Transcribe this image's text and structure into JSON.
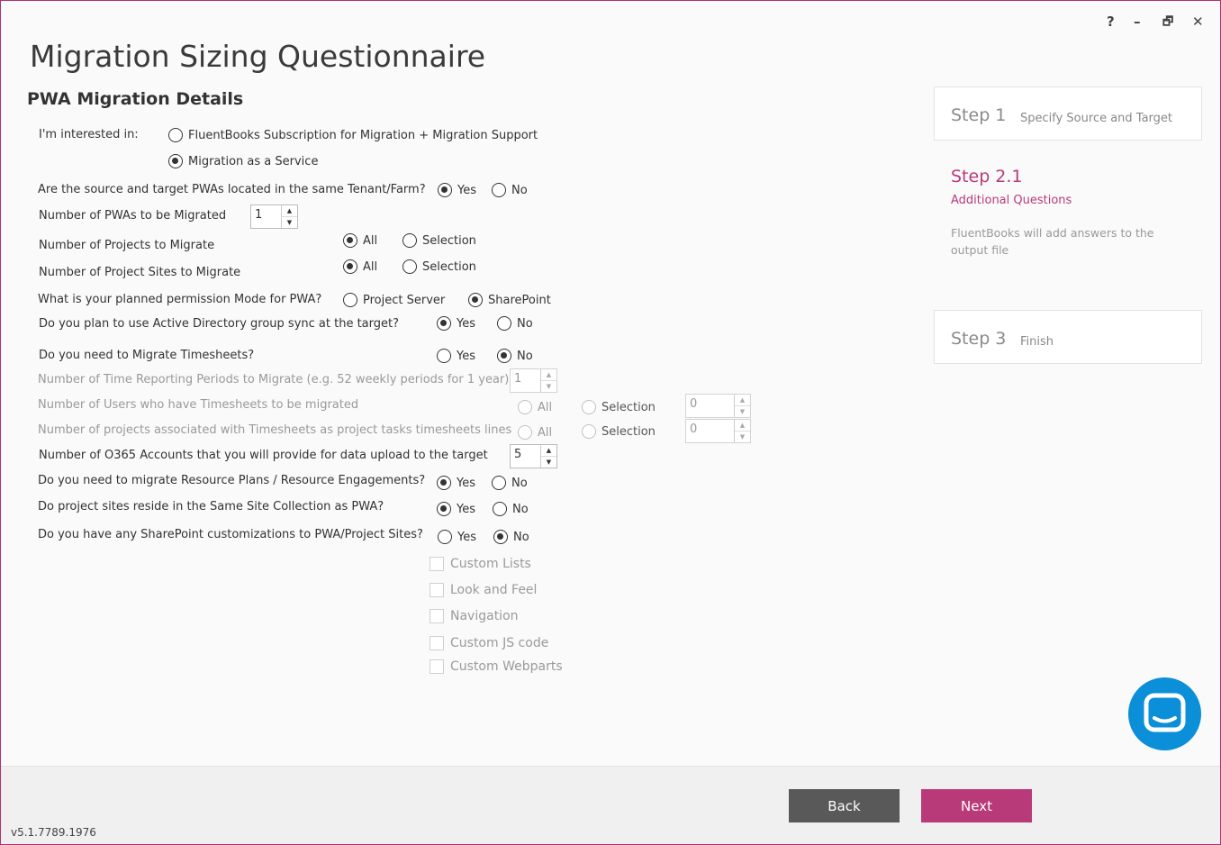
{
  "window_controls": {
    "help": "?",
    "minimize": "–",
    "restore": "🗗",
    "close": "✕"
  },
  "header": {
    "title": "Migration Sizing Questionnaire",
    "subtitle": "PWA Migration Details"
  },
  "form": {
    "interested": {
      "label": "I'm interested in:",
      "opt1": "FluentBooks Subscription for Migration + Migration Support",
      "opt2": "Migration as a Service"
    },
    "same_tenant": {
      "label": "Are the source and target PWAs located in the same Tenant/Farm?",
      "yes": "Yes",
      "no": "No"
    },
    "num_pwas": {
      "label": "Number of PWAs to be Migrated",
      "value": "1"
    },
    "num_projects": {
      "label": "Number of Projects to Migrate",
      "all": "All",
      "selection": "Selection"
    },
    "num_sites": {
      "label": "Number of Project Sites to Migrate",
      "all": "All",
      "selection": "Selection"
    },
    "permission_mode": {
      "label": "What is your planned permission Mode for PWA?",
      "opt1": "Project Server",
      "opt2": "SharePoint"
    },
    "ad_sync": {
      "label": "Do you plan to use Active Directory group sync at the target?",
      "yes": "Yes",
      "no": "No"
    },
    "timesheets": {
      "label": "Do you need to Migrate Timesheets?",
      "yes": "Yes",
      "no": "No"
    },
    "periods": {
      "label": "Number of Time Reporting Periods to Migrate (e.g. 52 weekly periods for 1 year)",
      "value": "1"
    },
    "ts_users": {
      "label": "Number of Users who have Timesheets to be migrated",
      "all": "All",
      "selection": "Selection",
      "value": "0"
    },
    "ts_projects": {
      "label": "Number of projects associated with Timesheets as project tasks timesheets lines",
      "all": "All",
      "selection": "Selection",
      "value": "0"
    },
    "o365": {
      "label": "Number of O365 Accounts that you will provide for data upload to the target",
      "value": "5"
    },
    "resource_plans": {
      "label": "Do you need to migrate Resource Plans / Resource Engagements?",
      "yes": "Yes",
      "no": "No"
    },
    "same_site": {
      "label": "Do project sites reside in the Same Site Collection as PWA?",
      "yes": "Yes",
      "no": "No"
    },
    "customizations": {
      "label": "Do you have any SharePoint customizations to PWA/Project Sites?",
      "yes": "Yes",
      "no": "No"
    },
    "checks": [
      "Custom Lists",
      "Look and Feel",
      "Navigation",
      "Custom JS code",
      "Custom Webparts"
    ]
  },
  "steps": {
    "step1": {
      "num": "Step 1",
      "desc": "Specify Source and Target"
    },
    "step2": {
      "num": "Step 2.1",
      "desc": "Additional Questions",
      "note": "FluentBooks will add answers to the output file"
    },
    "step3": {
      "num": "Step 3",
      "desc": "Finish"
    }
  },
  "footer": {
    "back": "Back",
    "next": "Next",
    "version": "v5.1.7789.1976"
  },
  "colors": {
    "accent": "#b83a78",
    "back_button": "#595959",
    "chat": "#0a8fd8",
    "window_border": "#b0306e"
  },
  "icons": {
    "chat": "chat-bubble-icon"
  }
}
